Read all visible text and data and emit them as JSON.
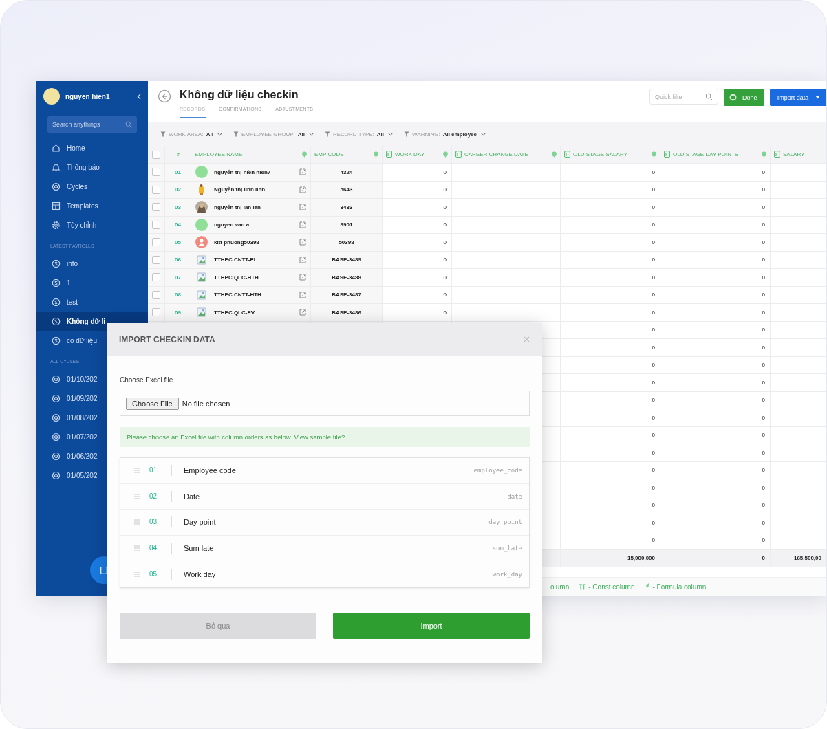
{
  "sidebar": {
    "user": {
      "name": "nguyen hien1"
    },
    "search": {
      "placeholder": "Search anythings"
    },
    "nav": [
      {
        "label": "Home",
        "kind": "home",
        "selected": false
      },
      {
        "label": "Thông báo",
        "kind": "bell",
        "selected": false
      },
      {
        "label": "Cycles",
        "kind": "cycle",
        "selected": false
      },
      {
        "label": "Templates",
        "kind": "template",
        "selected": false
      },
      {
        "label": "Tùy chỉnh",
        "kind": "gear",
        "selected": false
      }
    ],
    "sections": [
      {
        "title": "LATEST PAYROLLS",
        "items": [
          {
            "label": "info",
            "kind": "payroll",
            "selected": false
          },
          {
            "label": "1",
            "kind": "payroll",
            "selected": false
          },
          {
            "label": "test",
            "kind": "payroll",
            "selected": false
          },
          {
            "label": "Không dữ li",
            "kind": "payroll",
            "selected": true
          },
          {
            "label": "có dữ liệu",
            "kind": "payroll",
            "selected": false
          }
        ]
      },
      {
        "title": "ALL CYCLES",
        "items": [
          {
            "label": "01/10/202",
            "kind": "cycle",
            "selected": false
          },
          {
            "label": "01/09/202",
            "kind": "cycle",
            "selected": false
          },
          {
            "label": "01/08/202",
            "kind": "cycle",
            "selected": false
          },
          {
            "label": "01/07/202",
            "kind": "cycle",
            "selected": false
          },
          {
            "label": "01/06/202",
            "kind": "cycle",
            "selected": false
          },
          {
            "label": "01/05/202",
            "kind": "cycle",
            "selected": false
          }
        ]
      }
    ]
  },
  "header": {
    "title": "Không dữ liệu checkin",
    "tabs": [
      {
        "label": "RECORDS",
        "selected": true
      },
      {
        "label": "CONFIRMATIONS",
        "selected": false
      },
      {
        "label": "ADJUSTMENTS",
        "selected": false
      }
    ],
    "quick_filter": {
      "placeholder": "Quick filter"
    },
    "buttons": [
      {
        "label": "Done",
        "kind": "done"
      },
      {
        "label": "Import data",
        "kind": "import"
      }
    ]
  },
  "filters": [
    {
      "label": "WORK AREA:",
      "value": "All"
    },
    {
      "label": "EMPLOYEE GROUP:",
      "value": "All"
    },
    {
      "label": "RECORD TYPE:",
      "value": "All"
    },
    {
      "label": "WARNING:",
      "value": "All employee"
    }
  ],
  "table": {
    "select_all": {
      "checked": false
    },
    "columns": [
      {
        "label": "#",
        "kind": "plain",
        "menu": false
      },
      {
        "label": "EMPLOYEE NAME",
        "kind": "plain",
        "menu": true
      },
      {
        "label": "EMP CODE",
        "kind": "plain",
        "menu": true
      },
      {
        "label": "WORK DAY",
        "kind": "input",
        "menu": true
      },
      {
        "label": "CAREER CHANGE DATE",
        "kind": "input",
        "menu": true
      },
      {
        "label": "OLD STAGE SALARY",
        "kind": "input",
        "menu": true
      },
      {
        "label": "OLD STAGE DAY POINTS",
        "kind": "input",
        "menu": true
      },
      {
        "label": "SALARY",
        "kind": "input",
        "menu": false
      }
    ],
    "rows": [
      {
        "checked": false,
        "number": "01",
        "name": "nguyễn thị hiền hien7",
        "avatar": {
          "kind": "plain",
          "color": "#8fdf98"
        },
        "code": "4324",
        "work_day": "0",
        "old_stage_salary": "0",
        "old_stage_day_points": "0"
      },
      {
        "checked": false,
        "number": "02",
        "name": "Nguyễn thị linh linh",
        "avatar": {
          "kind": "figure",
          "color": "#f0b429"
        },
        "code": "5643",
        "work_day": "0",
        "old_stage_salary": "0",
        "old_stage_day_points": "0"
      },
      {
        "checked": false,
        "number": "03",
        "name": "nguyễn thị lan lan",
        "avatar": {
          "kind": "photo",
          "color": "#6b5a48"
        },
        "code": "3433",
        "work_day": "0",
        "old_stage_salary": "0",
        "old_stage_day_points": "0"
      },
      {
        "checked": false,
        "number": "04",
        "name": "nguyen van a",
        "avatar": {
          "kind": "plain",
          "color": "#8fdf98"
        },
        "code": "8901",
        "work_day": "0",
        "old_stage_salary": "0",
        "old_stage_day_points": "0"
      },
      {
        "checked": false,
        "number": "05",
        "name": "kitt phuong50398",
        "avatar": {
          "kind": "user",
          "color": "#f08a7e"
        },
        "code": "50398",
        "work_day": "0",
        "old_stage_salary": "0",
        "old_stage_day_points": "0"
      },
      {
        "checked": false,
        "number": "06",
        "name": "TTHPC CNTT-PL",
        "avatar": {
          "kind": "broken"
        },
        "code": "BASE-3489",
        "work_day": "0",
        "old_stage_salary": "0",
        "old_stage_day_points": "0"
      },
      {
        "checked": false,
        "number": "07",
        "name": "TTHPC QLC-HTH",
        "avatar": {
          "kind": "broken"
        },
        "code": "BASE-3488",
        "work_day": "0",
        "old_stage_salary": "0",
        "old_stage_day_points": "0"
      },
      {
        "checked": false,
        "number": "08",
        "name": "TTHPC CNTT-HTH",
        "avatar": {
          "kind": "broken"
        },
        "code": "BASE-3487",
        "work_day": "0",
        "old_stage_salary": "0",
        "old_stage_day_points": "0"
      },
      {
        "checked": false,
        "number": "09",
        "name": "TTHPC QLC-PV",
        "avatar": {
          "kind": "broken"
        },
        "code": "BASE-3486",
        "work_day": "0",
        "old_stage_salary": "0",
        "old_stage_day_points": "0"
      },
      {
        "old_stage_salary": "0",
        "old_stage_day_points": "0"
      },
      {
        "old_stage_salary": "0",
        "old_stage_day_points": "0"
      },
      {
        "old_stage_salary": "0",
        "old_stage_day_points": "0"
      },
      {
        "old_stage_salary": "0",
        "old_stage_day_points": "0"
      },
      {
        "old_stage_salary": "0",
        "old_stage_day_points": "0"
      },
      {
        "old_stage_salary": "0",
        "old_stage_day_points": "0"
      },
      {
        "old_stage_salary": "0",
        "old_stage_day_points": "0"
      },
      {
        "old_stage_salary": "0",
        "old_stage_day_points": "0"
      },
      {
        "old_stage_salary": "0",
        "old_stage_day_points": "0"
      },
      {
        "old_stage_salary": "0",
        "old_stage_day_points": "0"
      },
      {
        "old_stage_salary": "0",
        "old_stage_day_points": "0"
      },
      {
        "old_stage_salary": "0",
        "old_stage_day_points": "0"
      },
      {
        "old_stage_salary": "0",
        "old_stage_day_points": "0"
      }
    ],
    "total": {
      "old_stage_salary": "15,000,000",
      "old_stage_day_points": "0",
      "salary": "165,500,00"
    }
  },
  "legend": [
    {
      "label": "olumn",
      "kind": "none"
    },
    {
      "label": "- Const column",
      "kind": "const"
    },
    {
      "label": "- Formula column",
      "kind": "formula"
    }
  ],
  "dialog": {
    "title": "IMPORT CHECKIN DATA",
    "file_label": "Choose Excel file",
    "file_button": "Choose File",
    "file_status": "No file chosen",
    "hint": "Please choose an Excel file with column orders as below.",
    "hint_link": "View sample file?",
    "columns": [
      {
        "index": "01.",
        "label": "Employee code",
        "key": "employee_code"
      },
      {
        "index": "02.",
        "label": "Date",
        "key": "date"
      },
      {
        "index": "03.",
        "label": "Day point",
        "key": "day_point"
      },
      {
        "index": "04.",
        "label": "Sum late",
        "key": "sum_late"
      },
      {
        "index": "05.",
        "label": "Work day",
        "key": "work_day"
      }
    ],
    "buttons": [
      {
        "label": "Bỏ qua",
        "kind": "cancel"
      },
      {
        "label": "Import",
        "kind": "primary"
      }
    ]
  }
}
